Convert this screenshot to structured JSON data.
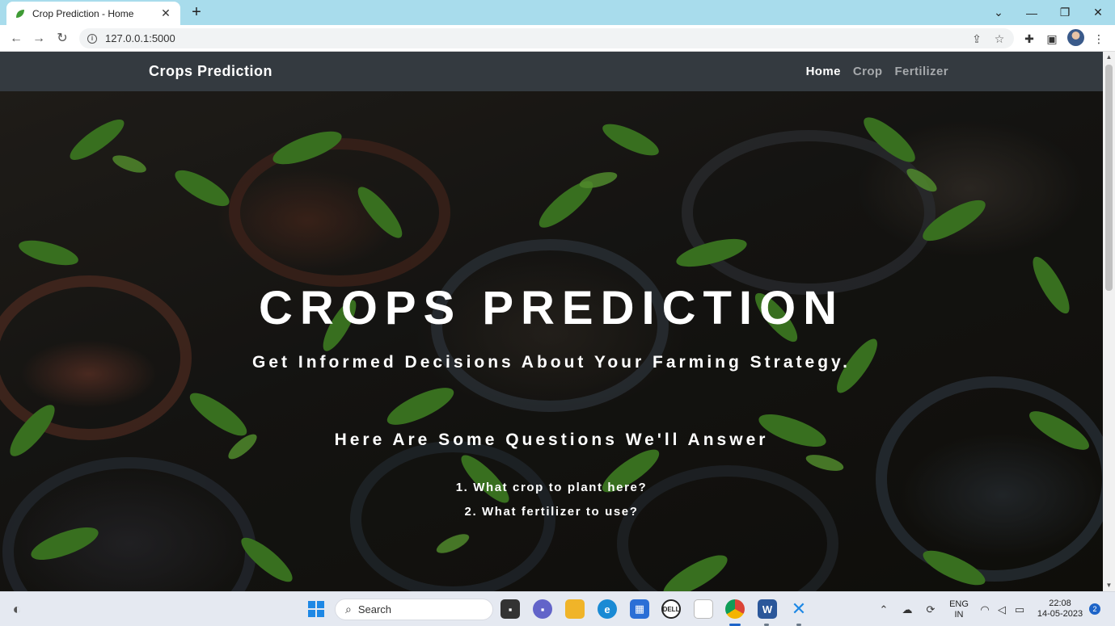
{
  "browser": {
    "tab_title": "Crop Prediction - Home",
    "url": "127.0.0.1:5000"
  },
  "site": {
    "brand": "Crops Prediction",
    "nav": [
      {
        "label": "Home",
        "active": true
      },
      {
        "label": "Crop",
        "active": false
      },
      {
        "label": "Fertilizer",
        "active": false
      }
    ]
  },
  "hero": {
    "title": "CROPS PREDICTION",
    "subtitle": "Get Informed Decisions About Your Farming Strategy.",
    "questions_heading": "Here Are Some Questions We'll Answer",
    "questions": [
      "1. What crop to plant here?",
      "2. What fertilizer to use?"
    ]
  },
  "taskbar": {
    "search_placeholder": "Search",
    "language": "ENG",
    "region": "IN",
    "time": "22:08",
    "date": "14-05-2023",
    "notification_count": "2"
  },
  "colors": {
    "navbar_bg": "#343a40",
    "tabbar_bg": "#a8dcec",
    "leaf_green": "#4e9a2c"
  }
}
